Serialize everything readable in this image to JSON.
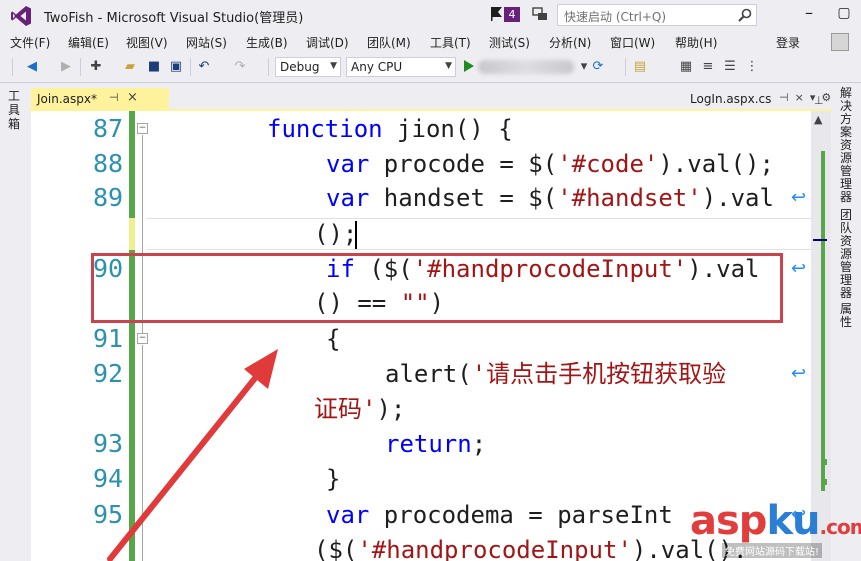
{
  "titlebar": {
    "title": "TwoFish - Microsoft Visual Studio(管理员)",
    "notification_count": "4",
    "quick_launch_placeholder": "快速启动 (Ctrl+Q)"
  },
  "menu": {
    "items": [
      "文件(F)",
      "编辑(E)",
      "视图(V)",
      "网站(S)",
      "生成(B)",
      "调试(D)",
      "团队(M)",
      "工具(T)",
      "测试(S)",
      "分析(N)",
      "窗口(W)",
      "帮助(H)"
    ],
    "login": "登录"
  },
  "toolbar": {
    "config": "Debug",
    "platform": "Any CPU"
  },
  "left_strip": {
    "label": "工具箱"
  },
  "right_strip": {
    "solution_explorer": "解决方案资源管理器",
    "team_explorer": "团队资源管理器",
    "properties": "属性"
  },
  "tabs": {
    "active": "Join.aspx*",
    "other": "LogIn.aspx.cs"
  },
  "editor": {
    "line_numbers": [
      "87",
      "88",
      "89",
      "90",
      "91",
      "92",
      "93",
      "94",
      "95"
    ],
    "lines": {
      "l87_kw": "function",
      "l87_rest": " jion() {",
      "l88_kw": "var",
      "l88_a": " procode = $(",
      "l88_str": "'#code'",
      "l88_b": ").val();",
      "l89_kw": "var",
      "l89_a": " handset = $(",
      "l89_str": "'#handset'",
      "l89_b": ").val",
      "l89_wrap": "();",
      "l90_kw": "if",
      "l90_a": " ($(",
      "l90_str": "'#handprocodeInput'",
      "l90_b": ").val",
      "l90_wrap_a": "() == ",
      "l90_wrap_str": "\"\"",
      "l90_wrap_b": ")",
      "l91": "{",
      "l92_a": "alert(",
      "l92_str": "'请点击手机按钮获取验",
      "l92_wrap_str": "证码'",
      "l92_wrap_b": ");",
      "l93_kw": "return",
      "l93_b": ";",
      "l94": "}",
      "l95_kw": "var",
      "l95_a": " procodema = parseInt",
      "l95_wrap_a": "($(",
      "l95_wrap_str": "'#handprocodeInput'",
      "l95_wrap_b": ").val()."
    }
  },
  "watermark": {
    "asp": "asp",
    "ku": "ku",
    "com": ".com",
    "sub": "免费网站源码下载站!"
  },
  "colors": {
    "keyword": "#0000ff",
    "string": "#a31515",
    "line_number": "#2b91af",
    "highlight_box": "#c9444c",
    "change_bar": "#57a64a",
    "tab_active": "#fff29d"
  }
}
